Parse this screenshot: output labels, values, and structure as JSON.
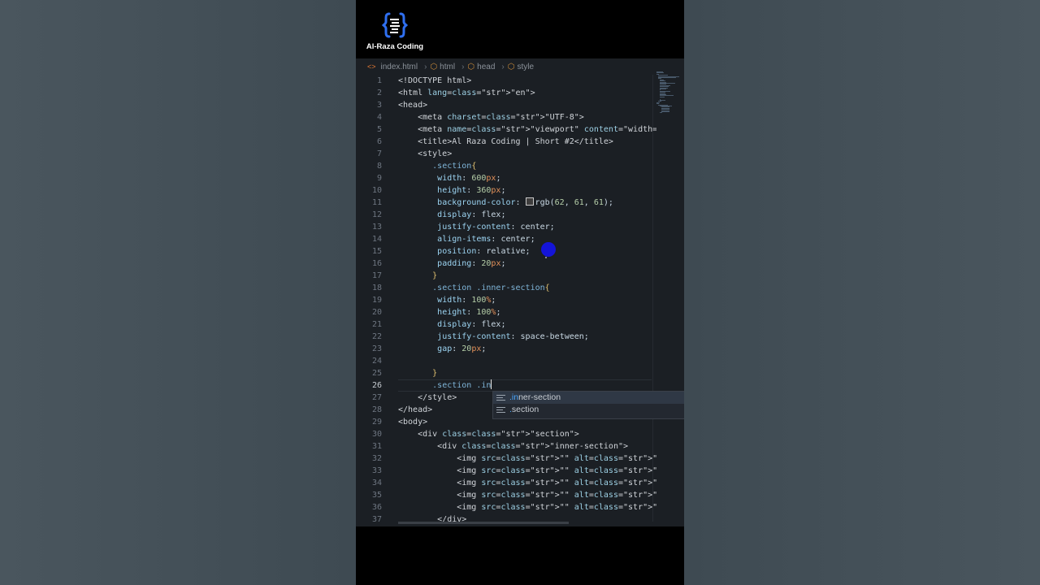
{
  "brand": {
    "name": "Al-Raza Coding",
    "accent": "#2f6ff0"
  },
  "breadcrumb": [
    {
      "label": "index.html",
      "icon": "html-file-icon"
    },
    {
      "label": "html",
      "icon": "element-icon"
    },
    {
      "label": "head",
      "icon": "element-icon"
    },
    {
      "label": "style",
      "icon": "element-icon"
    }
  ],
  "editor": {
    "current_line": 26,
    "lines": [
      "<!DOCTYPE html>",
      "<html lang=\"en\">",
      "<head>",
      "    <meta charset=\"UTF-8\">",
      "    <meta name=\"viewport\" content=\"width=device-widt",
      "    <title>Al Raza Coding | Short #2</title>",
      "    <style>",
      "       .section{",
      "        width: 600px;",
      "        height: 360px;",
      "        background-color: rgb(62, 61, 61);",
      "        display: flex;",
      "        justify-content: center;",
      "        align-items: center;",
      "        position: relative;",
      "        padding: 20px;",
      "       }",
      "       .section .inner-section{",
      "        width: 100%;",
      "        height: 100%;",
      "        display: flex;",
      "        justify-content: space-between;",
      "        gap: 20px;",
      "",
      "       }",
      "       .section .in",
      "    </style>",
      "</head>",
      "<body>",
      "    <div class=\"section\">",
      "        <div class=\"inner-section\">",
      "            <img src=\"\" alt=\"\">",
      "            <img src=\"\" alt=\"\">",
      "            <img src=\"\" alt=\"\">",
      "            <img src=\"\" alt=\"\">",
      "            <img src=\"\" alt=\"\">",
      "        </div>"
    ]
  },
  "autocomplete": {
    "typed": ".in",
    "items": [
      {
        "match": ".in",
        "rest": "ner-section",
        "icon": "css-class-icon"
      },
      {
        "match": ".",
        "rest": "section",
        "icon": "css-class-icon"
      }
    ]
  }
}
